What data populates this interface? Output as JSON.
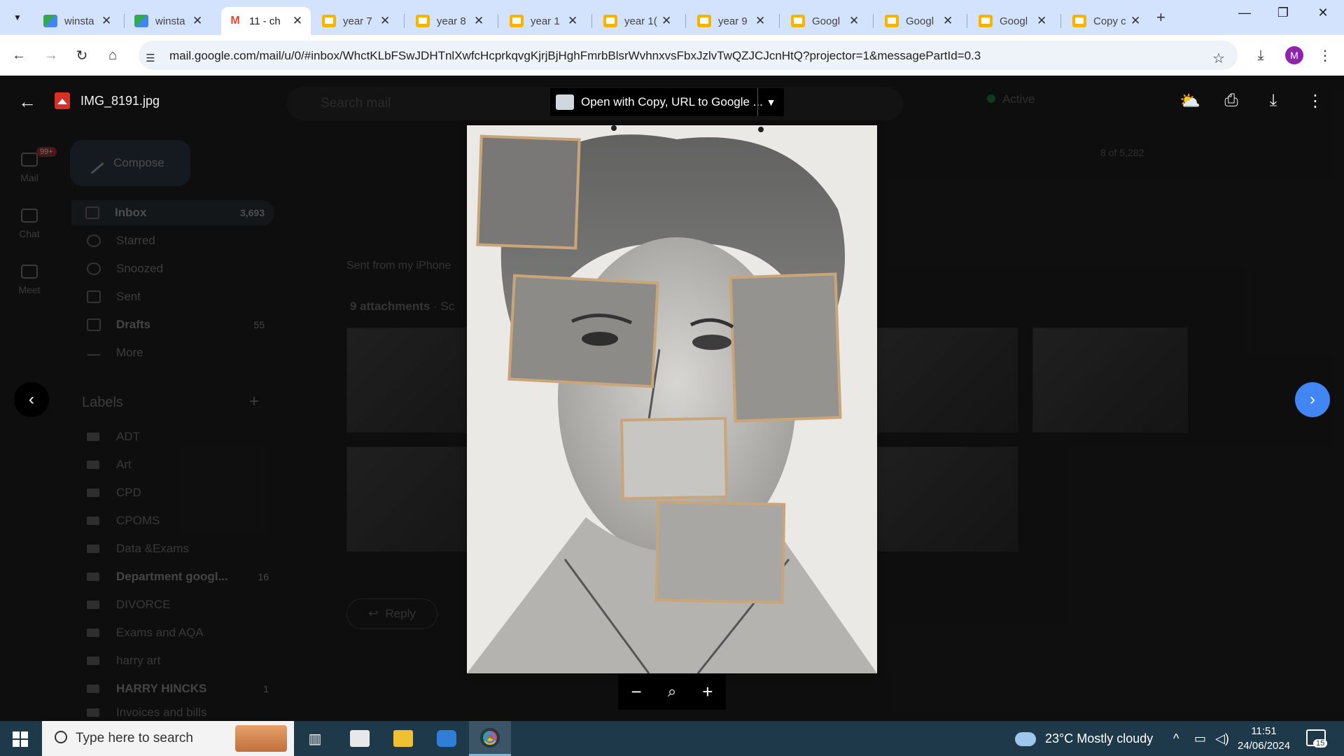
{
  "browser": {
    "tabs": [
      {
        "label": "winsta",
        "favicon": "winstanley-icon"
      },
      {
        "label": "winsta",
        "favicon": "winstanley-icon"
      },
      {
        "label": "11 - ch",
        "favicon": "gmail-icon",
        "active": true
      },
      {
        "label": "year 7",
        "favicon": "slides-icon"
      },
      {
        "label": "year 8",
        "favicon": "slides-icon"
      },
      {
        "label": "year 1",
        "favicon": "slides-icon"
      },
      {
        "label": "year 1(",
        "favicon": "slides-icon"
      },
      {
        "label": "year 9",
        "favicon": "slides-icon"
      },
      {
        "label": "Googl",
        "favicon": "slides-icon"
      },
      {
        "label": "Googl",
        "favicon": "slides-icon"
      },
      {
        "label": "Googl",
        "favicon": "slides-icon"
      },
      {
        "label": "Copy c",
        "favicon": "slides-icon"
      }
    ],
    "url": "mail.google.com/mail/u/0/#inbox/WhctKLbFSwJDHTnlXwfcHcprkqvgKjrjBjHghFmrbBlsrWvhnxvsFbxJzlvTwQZJCJcnHtQ?projector=1&messagePartId=0.3",
    "profile_initial": "M"
  },
  "gmail": {
    "rail": [
      {
        "label": "Mail",
        "badge": "99+"
      },
      {
        "label": "Chat"
      },
      {
        "label": "Meet"
      }
    ],
    "compose_label": "Compose",
    "nav": [
      {
        "label": "Inbox",
        "count": "3,693",
        "selected": true
      },
      {
        "label": "Starred",
        "count": ""
      },
      {
        "label": "Snoozed",
        "count": ""
      },
      {
        "label": "Sent",
        "count": ""
      },
      {
        "label": "Drafts",
        "count": "55",
        "bold": true
      },
      {
        "label": "More",
        "count": ""
      }
    ],
    "labels_heading": "Labels",
    "labels": [
      {
        "label": "ADT",
        "count": ""
      },
      {
        "label": "Art",
        "count": ""
      },
      {
        "label": "CPD",
        "count": ""
      },
      {
        "label": "CPOMS",
        "count": ""
      },
      {
        "label": "Data &Exams",
        "count": ""
      },
      {
        "label": "Department googl...",
        "count": "16",
        "bold": true
      },
      {
        "label": "DIVORCE",
        "count": ""
      },
      {
        "label": "Exams and AQA",
        "count": ""
      },
      {
        "label": "harry art",
        "count": ""
      },
      {
        "label": "HARRY HINCKS",
        "count": "1",
        "bold": true
      },
      {
        "label": "Invoices and bills",
        "count": ""
      }
    ],
    "search_placeholder": "Search mail",
    "status": "Active",
    "pager": "8 of 5,282",
    "sent_from": "Sent from my iPhone",
    "attachments_title": "9 attachments",
    "attachments_suffix": "· Sc",
    "reply_label": "Reply"
  },
  "viewer": {
    "filename": "IMG_8191.jpg",
    "open_with_label": "Open with Copy, URL to Google ...",
    "zoom_out": "−",
    "zoom_reset": "zoom-icon",
    "zoom_in": "+"
  },
  "taskbar": {
    "search_placeholder": "Type here to search",
    "weather": "23°C  Mostly cloudy",
    "time": "11:51",
    "date": "24/06/2024",
    "notifications": "15"
  }
}
